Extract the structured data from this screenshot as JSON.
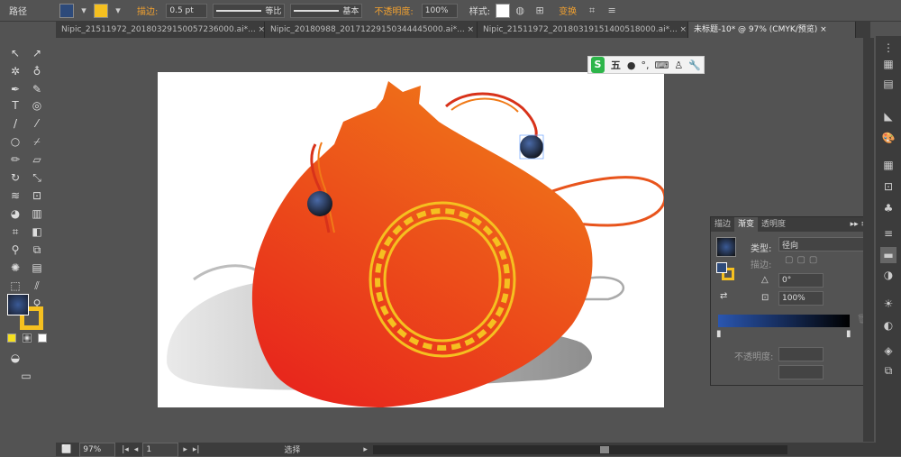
{
  "toolbar": {
    "path_label": "路径",
    "stroke_label": "描边:",
    "stroke_weight": "0.5 pt",
    "profile_label": "等比",
    "brush_label": "基本",
    "opacity_label": "不透明度:",
    "opacity_value": "100%",
    "style_label": "样式:",
    "transform_label": "变换"
  },
  "tabs": [
    {
      "label": "Nipic_21511972_20180329150057236000.ai*..."
    },
    {
      "label": "Nipic_20180988_20171229150344445000.ai*..."
    },
    {
      "label": "Nipic_21511972_20180319151400518000.ai*..."
    },
    {
      "label": "未标题-10* @ 97% (CMYK/预览)"
    }
  ],
  "ime": {
    "char": "五"
  },
  "gradient_panel": {
    "tab_stroke": "描边",
    "tab_gradient": "渐变",
    "tab_transparency": "透明度",
    "type_label": "类型:",
    "type_value": "径向",
    "stroke_label": "描边:",
    "angle_value": "0°",
    "ratio_value": "100%",
    "opacity_label": "不透明度:"
  },
  "status": {
    "zoom": "97%",
    "page": "1",
    "mode": "选择"
  },
  "colors": {
    "bag_top": "#f07a18",
    "bag_bottom": "#e8261c",
    "knot_yellow": "#f5c020",
    "bead": "#2d4a7a",
    "accent": "#f0a030"
  }
}
